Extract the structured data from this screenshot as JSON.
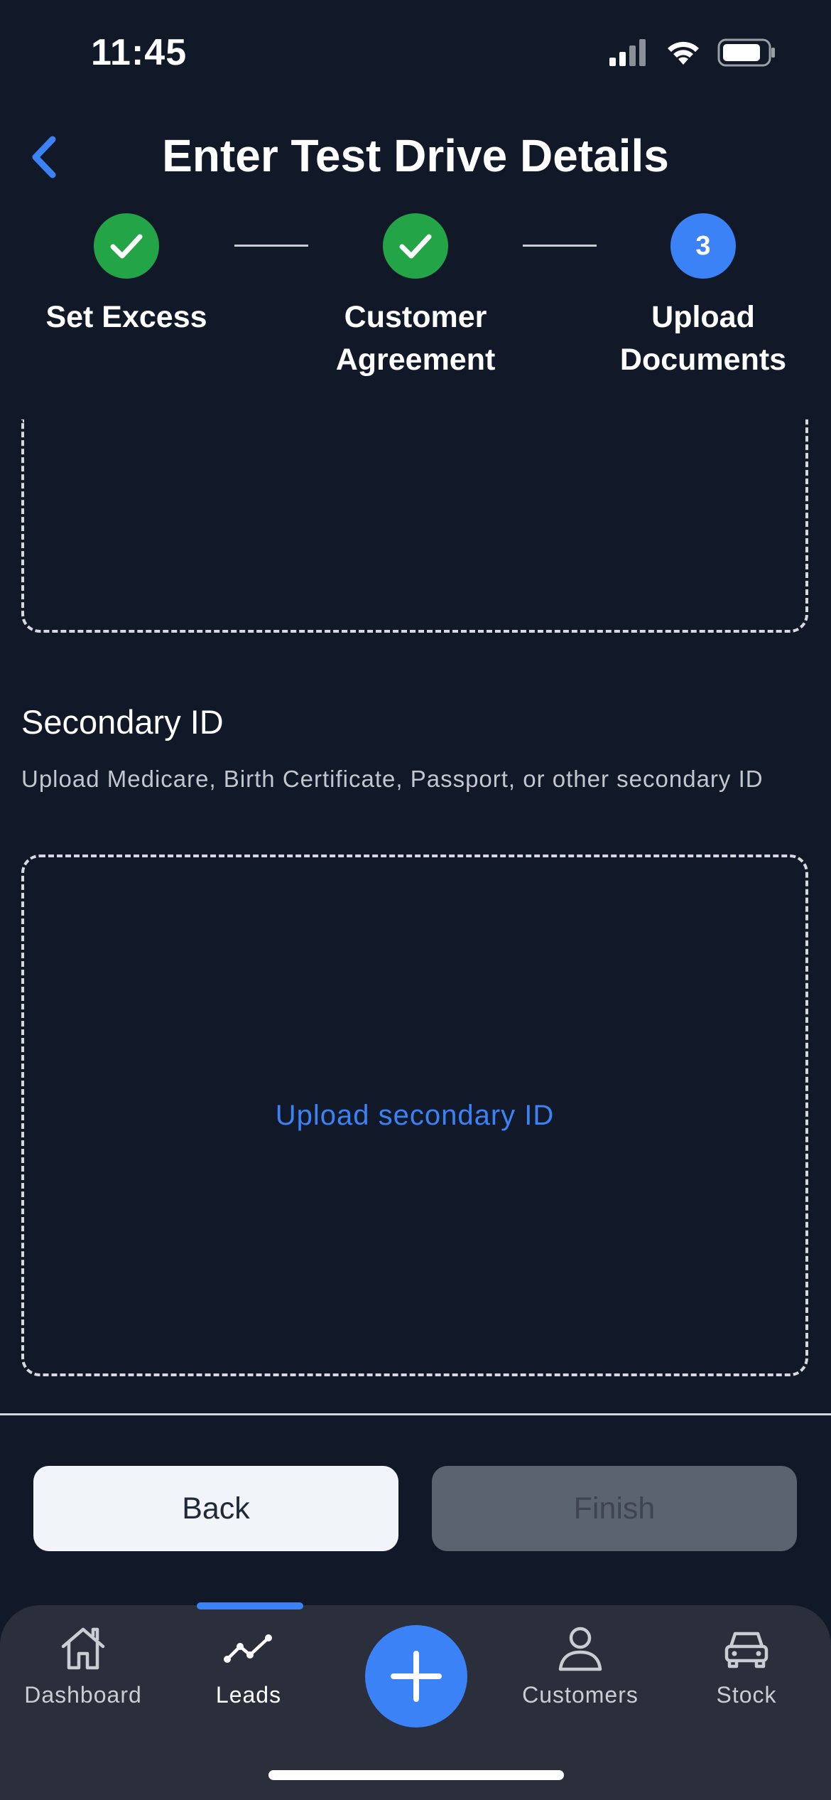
{
  "status_bar": {
    "time": "11:45"
  },
  "header": {
    "title": "Enter Test Drive Details"
  },
  "stepper": {
    "steps": [
      {
        "label": "Set Excess",
        "state": "complete"
      },
      {
        "label": "Customer Agreement",
        "state": "complete"
      },
      {
        "label": "Upload Documents",
        "state": "active",
        "number": "3"
      }
    ]
  },
  "secondary_id": {
    "title": "Secondary ID",
    "description": "Upload Medicare, Birth Certificate, Passport, or other secondary ID",
    "upload_label": "Upload secondary ID"
  },
  "footer": {
    "back_label": "Back",
    "finish_label": "Finish"
  },
  "nav": {
    "items": [
      {
        "label": "Dashboard",
        "icon": "home-icon"
      },
      {
        "label": "Leads",
        "icon": "trend-icon",
        "active": true
      },
      {
        "label": "Customers",
        "icon": "user-icon"
      },
      {
        "label": "Stock",
        "icon": "car-icon"
      }
    ],
    "fab_icon": "plus-icon"
  },
  "colors": {
    "background": "#111827",
    "accent": "#3b82f6",
    "success": "#22a447",
    "nav_background": "#2a2f3b"
  }
}
